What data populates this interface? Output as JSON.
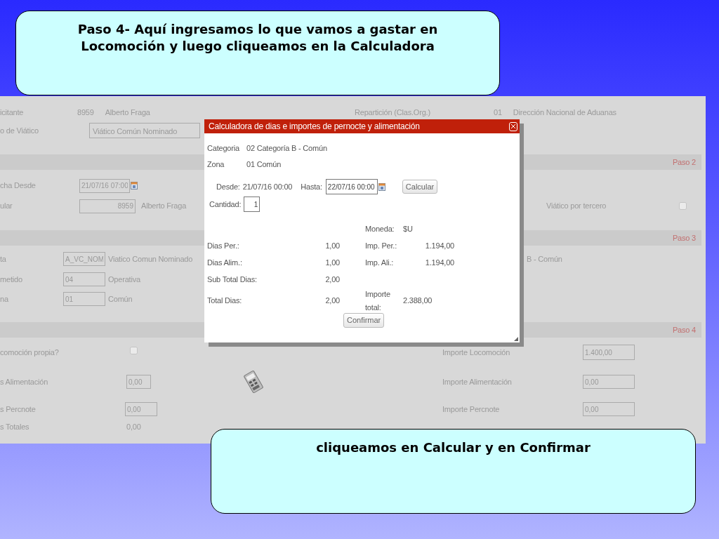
{
  "callout_top": {
    "text": "Paso 4- Aquí ingresamos lo que vamos a gastar en\nLocomoción y luego cliqueamos en la Calculadora"
  },
  "form": {
    "header": {
      "solicitante_label": "icitante",
      "solicitante_code": "8959",
      "solicitante_name": "Alberto Fraga",
      "reparticion_label": "Repartición (Clas.Org.)",
      "reparticion_code": "01",
      "reparticion_name": "Dirección Nacional de Aduanas",
      "tipo_label": "o de Viático",
      "tipo_value": "Viático Común Nominado"
    },
    "paso2": {
      "step": "Paso 2",
      "fecha_label": "cha Desde",
      "fecha_value": "21/07/16 07:00",
      "titular_label": "ular",
      "titular_code": "8959",
      "titular_name": "Alberto Fraga",
      "tercero_label": "Viático por tercero",
      "tercero_checked": false
    },
    "paso3": {
      "step": "Paso 3",
      "rows": [
        {
          "label": "ta",
          "code": "A_VC_NOM",
          "text": "Viatico Comun Nominado",
          "extra": "B - Común"
        },
        {
          "label": "metido",
          "code": "04",
          "text": "Operativa"
        },
        {
          "label": "na",
          "code": "01",
          "text": "Común"
        }
      ]
    },
    "paso4": {
      "step": "Paso 4",
      "locomocion_label": "comoción propia?",
      "locomocion_checked": false,
      "imp_locomocion_label": "Importe Locomoción",
      "imp_locomocion_value": "1.400,00",
      "alim_label": "s Alimentación",
      "alim_value": "0,00",
      "imp_alim_label": "Importe Alimentación",
      "imp_alim_value": "0,00",
      "perc_label": "s Percnote",
      "perc_value": "0,00",
      "imp_perc_label": "Importe Percnote",
      "imp_perc_value": "0,00",
      "totales_label": "s Totales",
      "totales_value": "0,00"
    }
  },
  "dialog": {
    "title": "Calculadora de dias e importes de pernocte y alimentación",
    "categoria_label": "Categoria",
    "categoria_value": "02 Categoría B - Común",
    "zona_label": "Zona",
    "zona_value": "01 Común",
    "desde_label": "Desde:",
    "desde_value": "21/07/16 00:00",
    "hasta_label": "Hasta:",
    "hasta_value": "22/07/16 00:00",
    "calcular": "Calcular",
    "cantidad_label": "Cantidad:",
    "cantidad_value": "1",
    "moneda_label": "Moneda:",
    "moneda_value": "$U",
    "rows": [
      {
        "label": "Dias Per.:",
        "value": "1,00",
        "imp_label": "Imp. Per.:",
        "imp_value": "1.194,00"
      },
      {
        "label": "Dias Alim.:",
        "value": "1,00",
        "imp_label": "Imp. Ali.:",
        "imp_value": "1.194,00"
      },
      {
        "label": "Sub Total Dias:",
        "value": "2,00"
      },
      {
        "label": "Total Dias:",
        "value": "2,00",
        "imp_label": "Importe total:",
        "total_value": "2.388,00"
      }
    ],
    "confirmar": "Confirmar"
  },
  "callout_bottom": {
    "text": "cliqueamos en Calcular y en Confirmar"
  }
}
